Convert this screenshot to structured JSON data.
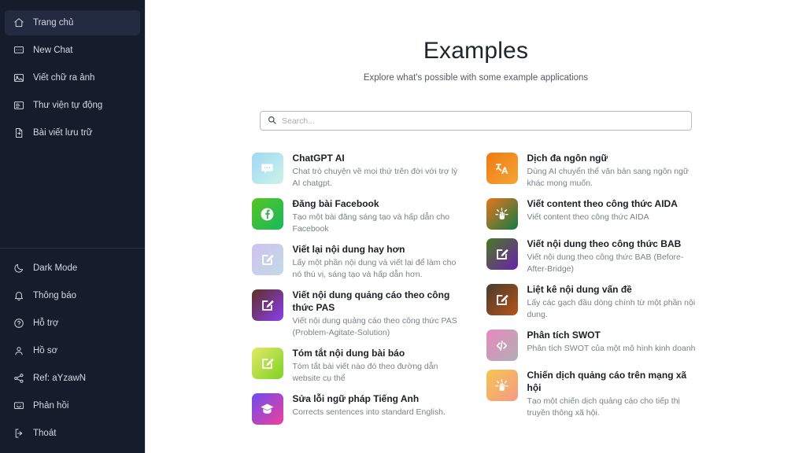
{
  "sidebar": {
    "top_items": [
      {
        "label": "Trang chủ",
        "icon": "home-icon",
        "active": true
      },
      {
        "label": "New Chat",
        "icon": "chat-icon",
        "active": false
      },
      {
        "label": "Viết chữ ra ảnh",
        "icon": "image-icon",
        "active": false
      },
      {
        "label": "Thư viện tự động",
        "icon": "library-icon",
        "active": false
      },
      {
        "label": "Bài viết lưu trữ",
        "icon": "document-icon",
        "active": false
      }
    ],
    "bottom_items": [
      {
        "label": "Dark Mode",
        "icon": "moon-icon"
      },
      {
        "label": "Thông báo",
        "icon": "bell-icon"
      },
      {
        "label": "Hỗ trợ",
        "icon": "question-circle-icon"
      },
      {
        "label": "Hồ sơ",
        "icon": "user-icon"
      },
      {
        "label": "Ref: aYzawN",
        "icon": "share-icon"
      },
      {
        "label": "Phản hồi",
        "icon": "feedback-icon"
      },
      {
        "label": "Thoát",
        "icon": "logout-icon"
      }
    ],
    "bg_color": "#151c2c",
    "active_bg_color": "#222b40"
  },
  "header": {
    "title": "Examples",
    "subtitle": "Explore what's possible with some example applications"
  },
  "search": {
    "placeholder": "Search...",
    "value": "",
    "icon": "search-icon"
  },
  "cards": {
    "left": [
      {
        "title": "ChatGPT AI",
        "desc": "Chat trò chuyện về mọi thứ trên đời với trợ lý AI chatgpt.",
        "icon": "chat-bubble-icon",
        "gradient_from": "#9fd8f5",
        "gradient_to": "#cdf3e6"
      },
      {
        "title": "Đăng bài Facebook",
        "desc": "Tạo một bài đăng sáng tạo và hấp dẫn cho Facebook",
        "icon": "facebook-icon",
        "gradient_from": "#59c425",
        "gradient_to": "#18b85c"
      },
      {
        "title": "Viết lại nội dung hay hơn",
        "desc": "Lấy một phần nội dung và viết lại để làm cho nó thú vị, sáng tạo và hấp dẫn hơn.",
        "icon": "edit-square-icon",
        "gradient_from": "#cfc1ee",
        "gradient_to": "#c3dbe8"
      },
      {
        "title": "Viết nội dung quảng cáo theo công thức PAS",
        "desc": "Viết nội dung quảng cáo theo công thức PAS (Problem-Agitate-Solution)",
        "icon": "edit-square-icon",
        "gradient_from": "#5e3024",
        "gradient_to": "#8b3ef0"
      },
      {
        "title": "Tóm tắt nội dung bài báo",
        "desc": "Tóm tắt bài viết nào đó theo đường dẫn website cụ thể",
        "icon": "edit-square-icon",
        "gradient_from": "#e3e86a",
        "gradient_to": "#7ed321"
      },
      {
        "title": "Sửa lỗi ngữ pháp Tiếng Anh",
        "desc": "Corrects sentences into standard English.",
        "icon": "graduation-cap-icon",
        "gradient_from": "#6c4df0",
        "gradient_to": "#f0409a"
      }
    ],
    "right": [
      {
        "title": "Dịch đa ngôn ngữ",
        "desc": "Dùng AI chuyển thể văn bản sang ngôn ngữ khác mong muốn.",
        "icon": "translate-icon",
        "gradient_from": "#f07a10",
        "gradient_to": "#f2a63a"
      },
      {
        "title": "Viết content theo công thức AIDA",
        "desc": "Viết content theo công thức AIDA",
        "icon": "idea-hand-icon",
        "gradient_from": "#e8751f",
        "gradient_to": "#127a44"
      },
      {
        "title": "Viết nội dung theo công thức BAB",
        "desc": "Viết nội dung theo công thức BAB (Before-After-Bridge)",
        "icon": "edit-square-icon",
        "gradient_from": "#4a7a1e",
        "gradient_to": "#6b1fb0"
      },
      {
        "title": "Liệt kê nội dung vấn đề",
        "desc": "Lấy các gạch đầu dòng chính từ một phần nội dung.",
        "icon": "edit-square-icon",
        "gradient_from": "#4a3b2e",
        "gradient_to": "#b5541a"
      },
      {
        "title": "Phân tích SWOT",
        "desc": "Phân tích SWOT của một mô hình kinh doanh",
        "icon": "code-icon",
        "gradient_from": "#e889bd",
        "gradient_to": "#b0aeb5"
      },
      {
        "title": "Chiến dịch quảng cáo trên mạng xã hội",
        "desc": "Tạo một chiến dịch quảng cáo cho tiếp thị truyền thông xã hội.",
        "icon": "idea-hand-icon",
        "gradient_from": "#f5c453",
        "gradient_to": "#f59a87"
      }
    ]
  }
}
